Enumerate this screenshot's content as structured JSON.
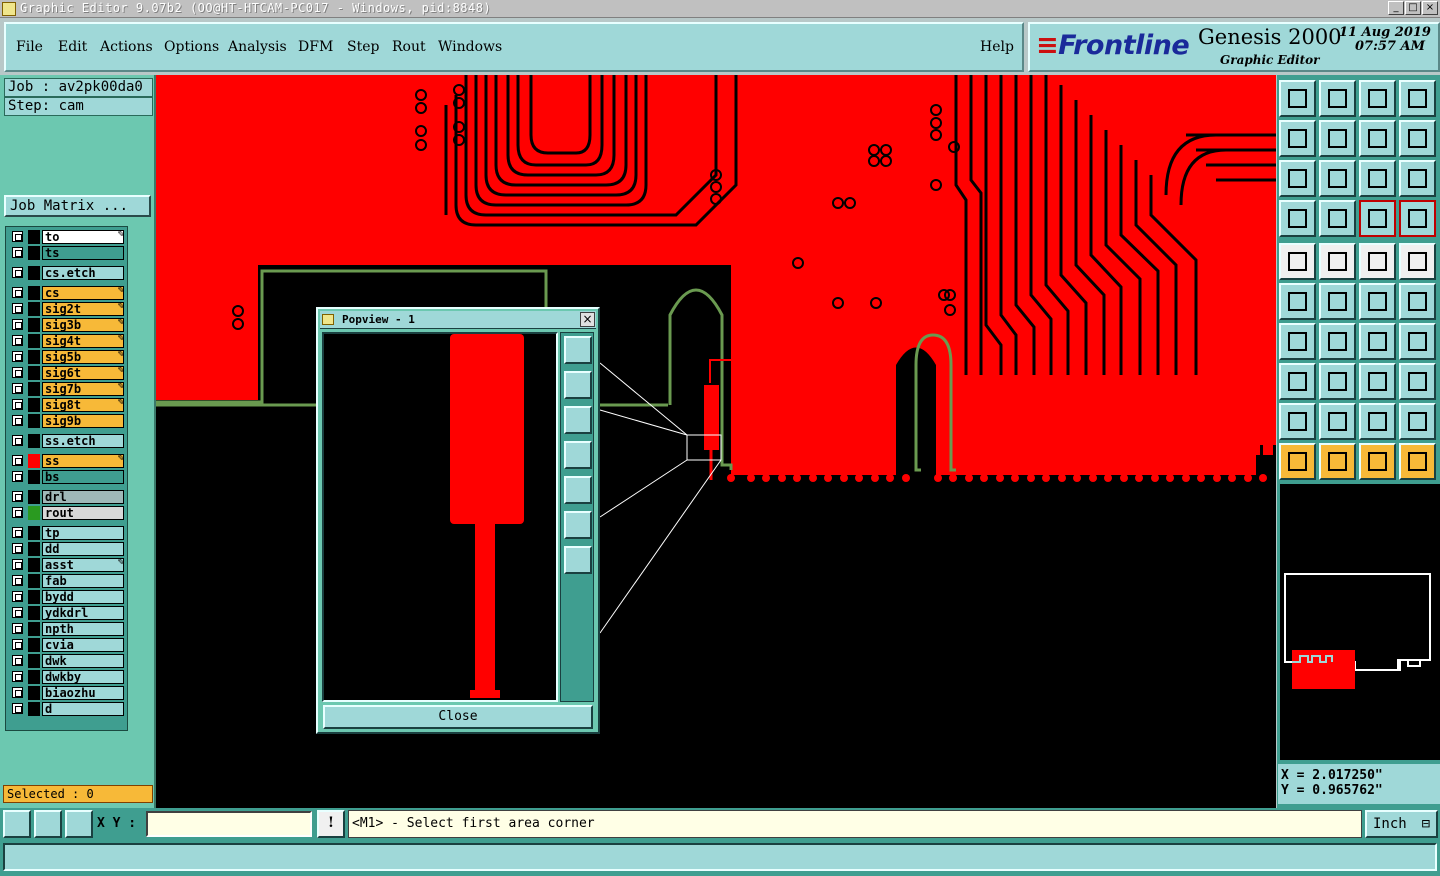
{
  "titlebar": {
    "text": "Graphic Editor 9.07b2 (OO@HT-HTCAM-PC017 - Windows, pid:8848)"
  },
  "menu": {
    "items": [
      "File",
      "Edit",
      "Actions",
      "Options",
      "Analysis",
      "DFM",
      "Step",
      "Rout",
      "Windows"
    ],
    "help": "Help"
  },
  "brand": {
    "logo": "Frontline",
    "product": "Genesis 2000",
    "subtitle": "Graphic Editor",
    "date": "11 Aug 2019",
    "time": "07:57 AM"
  },
  "job": {
    "job_label": "Job : av2pk00da0",
    "step_label": "Step: cam",
    "matrix_button": "Job Matrix ..."
  },
  "layers": [
    {
      "name": "to",
      "color": "#ffffff",
      "swatch": "#000000",
      "editable": true
    },
    {
      "name": "ts",
      "color": "#3f9e90",
      "swatch": "#000000",
      "editable": false
    },
    {
      "name": "cs.etch",
      "color": "#9fd8d8",
      "swatch": "#000000",
      "editable": false
    },
    {
      "name": "cs",
      "color": "#f7b938",
      "swatch": "#000000",
      "editable": true
    },
    {
      "name": "sig2t",
      "color": "#f7b938",
      "swatch": "#000000",
      "editable": true
    },
    {
      "name": "sig3b",
      "color": "#f7b938",
      "swatch": "#000000",
      "editable": true
    },
    {
      "name": "sig4t",
      "color": "#f7b938",
      "swatch": "#000000",
      "editable": true
    },
    {
      "name": "sig5b",
      "color": "#f7b938",
      "swatch": "#000000",
      "editable": true
    },
    {
      "name": "sig6t",
      "color": "#f7b938",
      "swatch": "#000000",
      "editable": true
    },
    {
      "name": "sig7b",
      "color": "#f7b938",
      "swatch": "#000000",
      "editable": true
    },
    {
      "name": "sig8t",
      "color": "#f7b938",
      "swatch": "#000000",
      "editable": true
    },
    {
      "name": "sig9b",
      "color": "#f7b938",
      "swatch": "#000000",
      "editable": false
    },
    {
      "name": "ss.etch",
      "color": "#9fd8d8",
      "swatch": "#000000",
      "editable": false
    },
    {
      "name": "ss",
      "color": "#f7b938",
      "swatch": "#ff0000",
      "editable": true
    },
    {
      "name": "bs",
      "color": "#3f9e90",
      "swatch": "#000000",
      "editable": false
    },
    {
      "name": "drl",
      "color": "#9fb8b8",
      "swatch": "#000000",
      "editable": false
    },
    {
      "name": "rout",
      "color": "#d8d8d8",
      "swatch": "#2a9a20",
      "editable": false
    },
    {
      "name": "tp",
      "color": "#9fd8d8",
      "swatch": "#000000",
      "editable": false
    },
    {
      "name": "dd",
      "color": "#9fd8d8",
      "swatch": "#000000",
      "editable": false
    },
    {
      "name": "asst",
      "color": "#9fd8d8",
      "swatch": "#000000",
      "editable": true
    },
    {
      "name": "fab",
      "color": "#9fd8d8",
      "swatch": "#000000",
      "editable": false
    },
    {
      "name": "bydd",
      "color": "#9fd8d8",
      "swatch": "#000000",
      "editable": false
    },
    {
      "name": "ydkdrl",
      "color": "#9fd8d8",
      "swatch": "#000000",
      "editable": false
    },
    {
      "name": "npth",
      "color": "#9fd8d8",
      "swatch": "#000000",
      "editable": false
    },
    {
      "name": "cvia",
      "color": "#9fd8d8",
      "swatch": "#000000",
      "editable": false
    },
    {
      "name": "dwk",
      "color": "#9fd8d8",
      "swatch": "#000000",
      "editable": false
    },
    {
      "name": "dwkby",
      "color": "#9fd8d8",
      "swatch": "#000000",
      "editable": false
    },
    {
      "name": "biaozhu",
      "color": "#9fd8d8",
      "swatch": "#000000",
      "editable": false
    },
    {
      "name": "d",
      "color": "#9fd8d8",
      "swatch": "#000000",
      "editable": false
    }
  ],
  "selected": "Selected : 0",
  "popview": {
    "title": "Popview - 1",
    "close": "Close"
  },
  "coords": {
    "x": "X = 2.017250\"",
    "y": "Y = 0.965762\""
  },
  "bottom": {
    "xy_label": "X Y :",
    "xy_value": "",
    "message": "<M1> - Select first area corner",
    "unit": "Inch"
  },
  "colors": {
    "copper": "#ff0000",
    "panel": "#9fd8d8",
    "outline": "#6a9a50"
  }
}
